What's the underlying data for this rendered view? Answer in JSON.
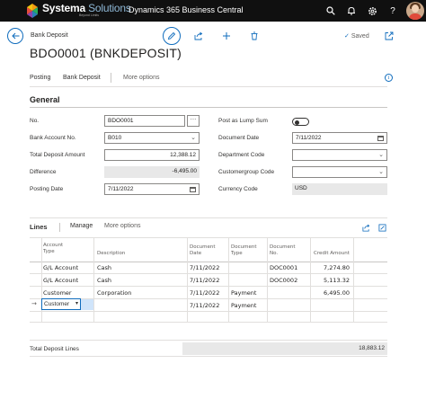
{
  "topbar": {
    "brand_main": "Systema",
    "brand_accent": " Solutions",
    "brand_sub": "Beyond Limits",
    "app_name": "Dynamics 365 Business Central",
    "icons": [
      "search-icon",
      "bell-icon",
      "settings-icon",
      "help-icon"
    ],
    "background": "#101010"
  },
  "header": {
    "breadcrumb": "Bank Deposit",
    "saved": "Saved",
    "title": "BDO0001 (BNKDEPOSIT)",
    "accent": "#0f6cbd"
  },
  "actions": {
    "posting": "Posting",
    "bank_deposit": "Bank Deposit",
    "more": "More options"
  },
  "general": {
    "heading": "General",
    "no_label": "No.",
    "no_value": "BDO0001",
    "dots": "···",
    "bank_account_label": "Bank Account No.",
    "bank_account_value": "B010",
    "total_deposit_label": "Total Deposit Amount",
    "total_deposit_value": "12,388.12",
    "difference_label": "Difference",
    "difference_value": "-6,495.00",
    "posting_date_label": "Posting Date",
    "posting_date_value": "7/11/2022",
    "lump_sum_label": "Post as Lump Sum",
    "lump_sum_on": false,
    "document_date_label": "Document Date",
    "document_date_value": "7/11/2022",
    "department_label": "Department Code",
    "department_value": "",
    "customergroup_label": "Customergroup Code",
    "customergroup_value": "",
    "currency_label": "Currency Code",
    "currency_value": "USD"
  },
  "lines": {
    "heading": "Lines",
    "manage": "Manage",
    "more": "More options",
    "columns": {
      "account_type": "Account Type",
      "description": "Description",
      "document_date": "Document Date",
      "document_type": "Document Type",
      "document_no": "Document No.",
      "credit_amount": "Credit Amount"
    },
    "rows": [
      {
        "account_type": "G/L Account",
        "description": "Cash",
        "document_date": "7/11/2022",
        "document_type": "",
        "document_no": "DOC0001",
        "credit_amount": "7,274.80"
      },
      {
        "account_type": "G/L Account",
        "description": "Cash",
        "document_date": "7/11/2022",
        "document_type": "",
        "document_no": "DOC0002",
        "credit_amount": "5,113.32"
      },
      {
        "account_type": "Customer",
        "description": "Corporation",
        "document_date": "7/11/2022",
        "document_type": "Payment",
        "document_no": "",
        "credit_amount": "6,495.00"
      },
      {
        "account_type": "Customer",
        "description": "",
        "document_date": "7/11/2022",
        "document_type": "Payment",
        "document_no": "",
        "credit_amount": ""
      }
    ],
    "row_arrow": "→"
  },
  "totals": {
    "label": "Total Deposit Lines",
    "value": "18,883.12"
  }
}
